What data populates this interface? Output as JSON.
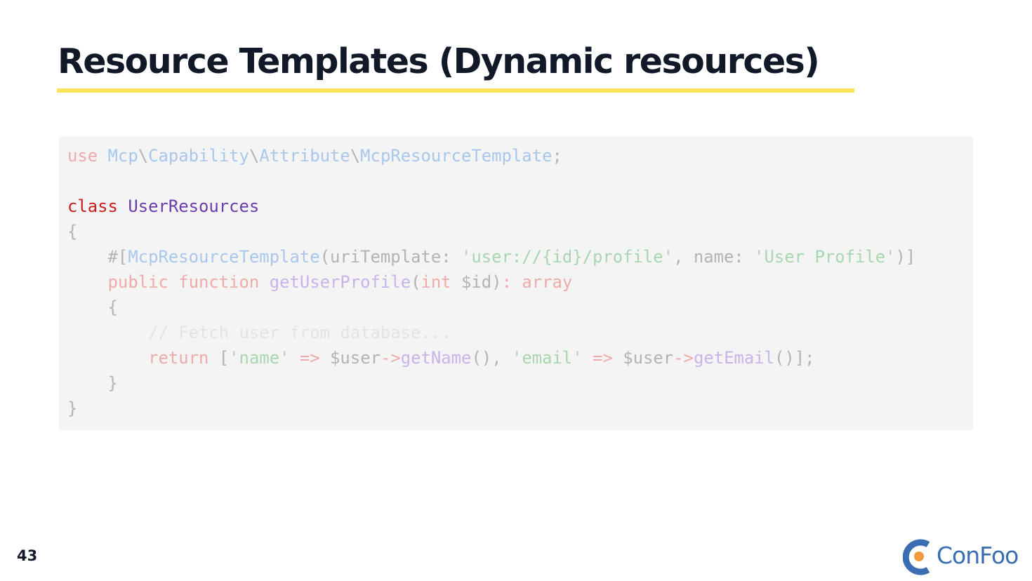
{
  "slide": {
    "title": "Resource Templates (Dynamic resources)",
    "page_number": "43",
    "logo_text": "ConFoo",
    "accent_color": "#fde35a",
    "brand_color": "#3a6db1",
    "brand_dot_color": "#f39a3a"
  },
  "code": {
    "language": "php",
    "lines": [
      [
        {
          "t": "use",
          "c": "kw-dim"
        },
        {
          "t": " ",
          "c": "plain"
        },
        {
          "t": "Mcp",
          "c": "ns"
        },
        {
          "t": "\\",
          "c": "punct"
        },
        {
          "t": "Capability",
          "c": "ns"
        },
        {
          "t": "\\",
          "c": "punct"
        },
        {
          "t": "Attribute",
          "c": "ns"
        },
        {
          "t": "\\",
          "c": "punct"
        },
        {
          "t": "McpResourceTemplate",
          "c": "ns"
        },
        {
          "t": ";",
          "c": "plain"
        }
      ],
      [],
      [
        {
          "t": "class",
          "c": "kw-strong"
        },
        {
          "t": " ",
          "c": "plain"
        },
        {
          "t": "UserResources",
          "c": "cls-strong"
        }
      ],
      [
        {
          "t": "{",
          "c": "plain"
        }
      ],
      [
        {
          "t": "    ",
          "c": "plain"
        },
        {
          "t": "#[",
          "c": "plain"
        },
        {
          "t": "McpResourceTemplate",
          "c": "attr"
        },
        {
          "t": "(uriTemplate: ",
          "c": "plain"
        },
        {
          "t": "'user://{id}/profile'",
          "c": "str"
        },
        {
          "t": ", name: ",
          "c": "plain"
        },
        {
          "t": "'User Profile'",
          "c": "str"
        },
        {
          "t": ")]",
          "c": "plain"
        }
      ],
      [
        {
          "t": "    ",
          "c": "plain"
        },
        {
          "t": "public",
          "c": "kw-dim"
        },
        {
          "t": " ",
          "c": "plain"
        },
        {
          "t": "function",
          "c": "kw-dim"
        },
        {
          "t": " ",
          "c": "plain"
        },
        {
          "t": "getUserProfile",
          "c": "fn"
        },
        {
          "t": "(",
          "c": "plain"
        },
        {
          "t": "int",
          "c": "kw-dim"
        },
        {
          "t": " $id)",
          "c": "var"
        },
        {
          "t": ": ",
          "c": "op"
        },
        {
          "t": "array",
          "c": "kw-dim"
        }
      ],
      [
        {
          "t": "    {",
          "c": "plain"
        }
      ],
      [
        {
          "t": "        ",
          "c": "plain"
        },
        {
          "t": "// Fetch user from database...",
          "c": "comment"
        }
      ],
      [
        {
          "t": "        ",
          "c": "plain"
        },
        {
          "t": "return",
          "c": "kw-dim"
        },
        {
          "t": " [",
          "c": "plain"
        },
        {
          "t": "'name'",
          "c": "str"
        },
        {
          "t": " ",
          "c": "plain"
        },
        {
          "t": "=>",
          "c": "op"
        },
        {
          "t": " $user",
          "c": "var"
        },
        {
          "t": "->",
          "c": "op"
        },
        {
          "t": "getName",
          "c": "fn"
        },
        {
          "t": "(), ",
          "c": "plain"
        },
        {
          "t": "'email'",
          "c": "str"
        },
        {
          "t": " ",
          "c": "plain"
        },
        {
          "t": "=>",
          "c": "op"
        },
        {
          "t": " $user",
          "c": "var"
        },
        {
          "t": "->",
          "c": "op"
        },
        {
          "t": "getEmail",
          "c": "fn"
        },
        {
          "t": "()];",
          "c": "plain"
        }
      ],
      [
        {
          "t": "    }",
          "c": "plain"
        }
      ],
      [
        {
          "t": "}",
          "c": "plain"
        }
      ]
    ]
  }
}
